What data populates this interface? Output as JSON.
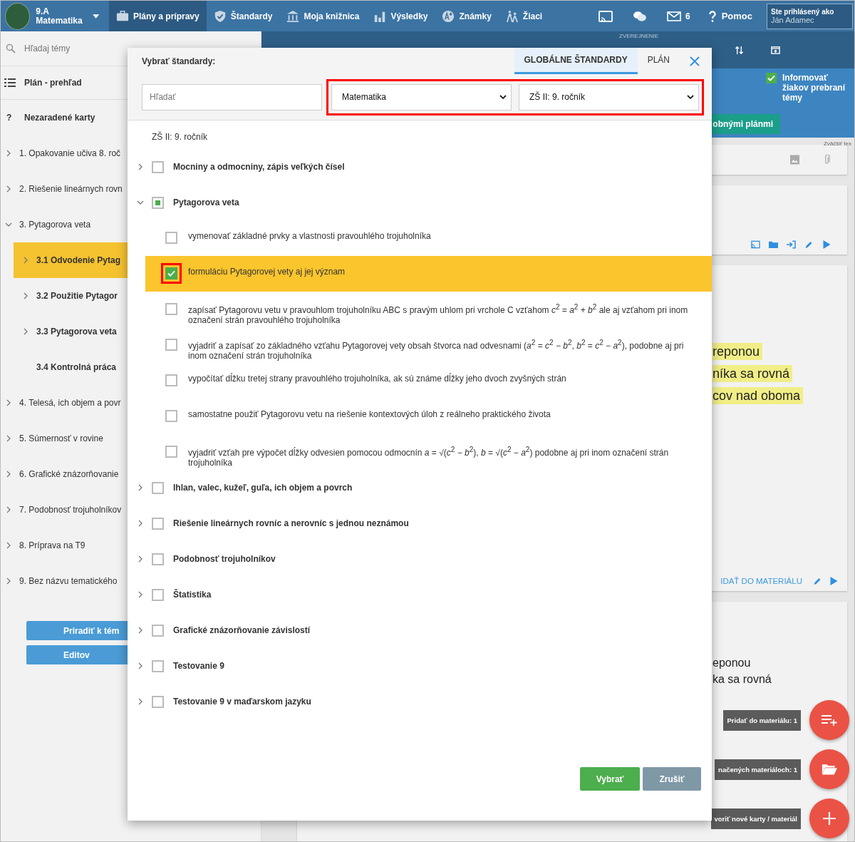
{
  "topbar": {
    "class_name": "9.A",
    "subject": "Matematika",
    "nav": [
      {
        "label": "Plány a prípravy",
        "selected": true
      },
      {
        "label": "Štandardy",
        "selected": false
      },
      {
        "label": "Moja knižnica",
        "selected": false
      },
      {
        "label": "Výsledky",
        "selected": false
      },
      {
        "label": "Známky",
        "selected": false
      },
      {
        "label": "Žiaci",
        "selected": false
      }
    ],
    "mail_count": "6",
    "help": "Pomoc",
    "user_caption": "Ste prihlásený ako",
    "user_name": "Ján Adamec"
  },
  "sidebar": {
    "search_placeholder": "Hľadaj témy",
    "overview": "Plán - prehľad",
    "unassigned_mark": "?",
    "unassigned": "Nezaradené karty",
    "items": [
      {
        "label": "1. Opakovanie učiva 8. roč",
        "expanded": false,
        "selected": false
      },
      {
        "label": "2. Riešenie lineárnych rovn",
        "expanded": false,
        "selected": false
      },
      {
        "label": "3. Pytagorova veta",
        "expanded": true,
        "selected": false,
        "children": [
          {
            "label": "3.1 Odvodenie Pytag",
            "expandable": true,
            "selected": true
          },
          {
            "label": "3.2 Použitie Pytagor",
            "expandable": true,
            "selected": false
          },
          {
            "label": "3.3 Pytagorova veta",
            "expandable": true,
            "selected": false
          },
          {
            "label": "3.4 Kontrolná práca",
            "expandable": false,
            "selected": false
          }
        ]
      },
      {
        "label": "4. Telesá, ich objem a povr",
        "expanded": false,
        "selected": false
      },
      {
        "label": "5. Súmernosť v rovine",
        "expanded": false,
        "selected": false
      },
      {
        "label": "6. Grafické znázorňovanie",
        "expanded": false,
        "selected": false
      },
      {
        "label": "7. Podobnosť trojuholníkov",
        "expanded": false,
        "selected": false
      },
      {
        "label": "8. Príprava na T9",
        "expanded": false,
        "selected": false
      },
      {
        "label": "9. Bez názvu tematického",
        "expanded": false,
        "selected": false
      }
    ],
    "buttons": [
      "Priradiť k tém",
      "Editov"
    ]
  },
  "main": {
    "toolbar_label": "ZVEREJNENIE",
    "notify": {
      "label": "Informovať žiakov prebraní témy",
      "checked": true
    },
    "green_button": "obnými plánmi",
    "editor_hint": "Zväčšiť tex",
    "card_texts": [
      "reponou",
      "níka sa rovná",
      "cov nad oboma"
    ],
    "card_link": "IDAŤ DO MATERIÁLU",
    "card2_texts": [
      "eponou",
      "ka sa rovná"
    ],
    "fabs": [
      {
        "tooltip": "Pridať do materiálu: 1"
      },
      {
        "tooltip": "načených materiáloch: 1"
      },
      {
        "tooltip": "voriť nové karty / materiál"
      }
    ]
  },
  "dialog": {
    "title": "Vybrať štandardy:",
    "tabs": [
      {
        "label": "GLOBÁLNE ŠTANDARDY",
        "selected": true
      },
      {
        "label": "PLÁN",
        "selected": false
      }
    ],
    "search_placeholder": "Hľadať",
    "subject": "Matematika",
    "grade": "ZŠ II: 9. ročník",
    "filters_annotated": true,
    "heading": "ZŠ II: 9. ročník",
    "topics": [
      {
        "label": "Mocniny a odmocniny, zápis veľkých čísel",
        "checked": false,
        "partial": false,
        "expanded": false
      },
      {
        "label": "Pytagorova veta",
        "checked": false,
        "partial": true,
        "expanded": true,
        "children": [
          {
            "label": "vymenovať základné prvky a vlastnosti pravouhlého trojuholníka",
            "checked": false,
            "annotated": false
          },
          {
            "label": "formuláciu Pytagorovej vety aj jej význam",
            "checked": true,
            "annotated": true
          },
          {
            "label": "zapísať Pytagorovu vetu v pravouhlom trojuholníku ABC s pravým uhlom pri vrchole C vzťahom *c*$^{2}$ = *a*$^{2}$ + *b*$^{2}$ ale aj vzťahom pri inom označení strán pravouhlého trojuholníka",
            "checked": false,
            "annotated": false
          },
          {
            "label": "vyjadriť a zapísať zo základného vzťahu Pytagorovej vety obsah štvorca nad odvesnami (*a*$^{2}$ = *c*$^{2}$ − *b*$^{2}$, *b*$^{2}$ = *c*$^{2}$ − *a*$^{2}$), podobne aj pri inom označení strán trojuholníka",
            "checked": false,
            "annotated": false
          },
          {
            "label": "vypočítať dĺžku tretej strany pravouhlého trojuholníka, ak sú známe dĺžky jeho dvoch zvyšných strán",
            "checked": false,
            "annotated": false
          },
          {
            "label": "samostatne použiť Pytagorovu vetu na riešenie kontextových úloh z reálneho praktického života",
            "checked": false,
            "annotated": false
          },
          {
            "label": "vyjadriť vzťah pre výpočet dĺžky odvesien pomocou odmocnín *a* = √(*c*$^{2}$ − *b*$^{2}$), *b* = √(*c*$^{2}$ − *a*$^{2}$) podobne aj pri inom označení strán trojuholníka",
            "checked": false,
            "annotated": false
          }
        ]
      },
      {
        "label": "Ihlan, valec, kužeľ, guľa, ich objem a povrch",
        "checked": false,
        "partial": false,
        "expanded": false
      },
      {
        "label": "Riešenie lineárnych rovníc a nerovníc s jednou neznámou",
        "checked": false,
        "partial": false,
        "expanded": false
      },
      {
        "label": "Podobnosť trojuholníkov",
        "checked": false,
        "partial": false,
        "expanded": false
      },
      {
        "label": "Štatistika",
        "checked": false,
        "partial": false,
        "expanded": false
      },
      {
        "label": "Grafické znázorňovanie závislostí",
        "checked": false,
        "partial": false,
        "expanded": false
      },
      {
        "label": "Testovanie 9",
        "checked": false,
        "partial": false,
        "expanded": false
      },
      {
        "label": "Testovanie 9 v maďarskom jazyku",
        "checked": false,
        "partial": false,
        "expanded": false
      }
    ],
    "confirm": "Vybrať",
    "cancel": "Zrušiť"
  }
}
